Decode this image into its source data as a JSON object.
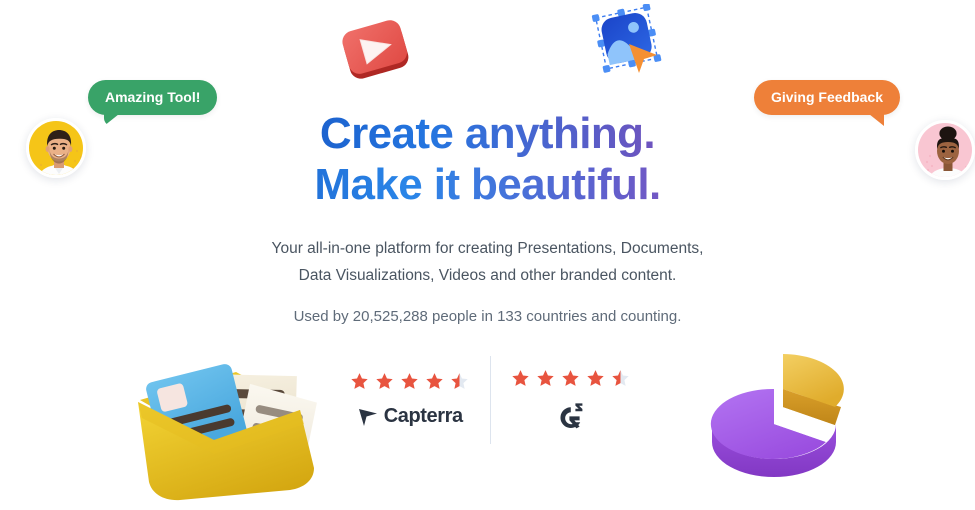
{
  "hero": {
    "headline_line1": "Create anything.",
    "headline_line2": "Make it beautiful.",
    "subtitle_line1": "Your all-in-one platform for creating Presentations, Documents,",
    "subtitle_line2": "Data Visualizations, Videos and other branded content.",
    "usage_text": "Used by 20,525,288 people in 133 countries and counting."
  },
  "badges": {
    "left": {
      "label": "Amazing Tool!",
      "color": "#39a368",
      "avatar_bg": "#f5c518"
    },
    "right": {
      "label": "Giving Feedback",
      "color": "#ee8039",
      "avatar_bg": "#f9c6d2"
    }
  },
  "reviews": {
    "star_color": "#e8543f",
    "star_empty_color": "#e3e9f1",
    "items": [
      {
        "name": "Capterra",
        "rating": 4.5,
        "max": 5,
        "logo_label": "Capterra"
      },
      {
        "name": "G2",
        "rating": 4.5,
        "max": 5,
        "logo_label": "G2"
      }
    ]
  },
  "illustrations": {
    "video_icon": {
      "name": "video-play-card",
      "colors": [
        "#e8564f",
        "#c9342f",
        "#ffffff"
      ]
    },
    "image_icon": {
      "name": "image-select-cursor",
      "colors": [
        "#1f4fd8",
        "#4b8ef5",
        "#f59033"
      ]
    },
    "folder_icon": {
      "name": "documents-folder",
      "colors": [
        "#e8c021",
        "#5bb8e8",
        "#f0e6d2"
      ]
    },
    "pie_icon": {
      "name": "pie-chart-3d",
      "colors": [
        "#a855e8",
        "#e8b93f"
      ]
    }
  }
}
